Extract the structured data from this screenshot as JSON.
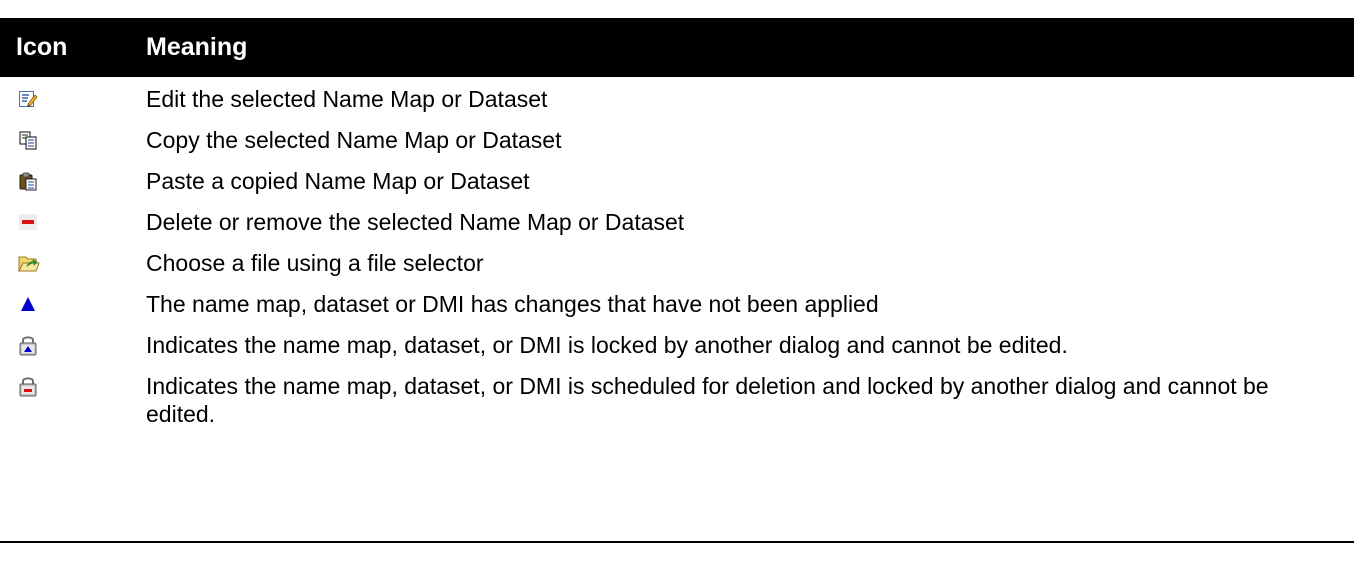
{
  "table": {
    "headers": {
      "icon": "Icon",
      "meaning": "Meaning"
    },
    "rows": [
      {
        "icon": "edit-icon",
        "meaning": "Edit the selected Name Map or Dataset"
      },
      {
        "icon": "copy-icon",
        "meaning": "Copy the selected Name Map or Dataset"
      },
      {
        "icon": "paste-icon",
        "meaning": "Paste a copied Name Map or Dataset"
      },
      {
        "icon": "delete-icon",
        "meaning": "Delete or remove the selected Name Map or Dataset"
      },
      {
        "icon": "open-folder-icon",
        "meaning": "Choose a file using a file selector"
      },
      {
        "icon": "changes-pending-triangle-icon",
        "meaning": "The name map, dataset or DMI has changes that have not been applied"
      },
      {
        "icon": "locked-icon",
        "meaning": "Indicates the name map, dataset, or DMI is locked by another dialog and cannot be edited."
      },
      {
        "icon": "locked-delete-icon",
        "meaning": "Indicates the name map, dataset, or DMI is scheduled for deletion and locked by another dialog and cannot be edited."
      }
    ]
  },
  "colors": {
    "header_bg": "#000000",
    "header_text": "#ffffff",
    "accent_blue": "#0000cc",
    "delete_red": "#e01010",
    "folder_yellow": "#f0c850"
  }
}
